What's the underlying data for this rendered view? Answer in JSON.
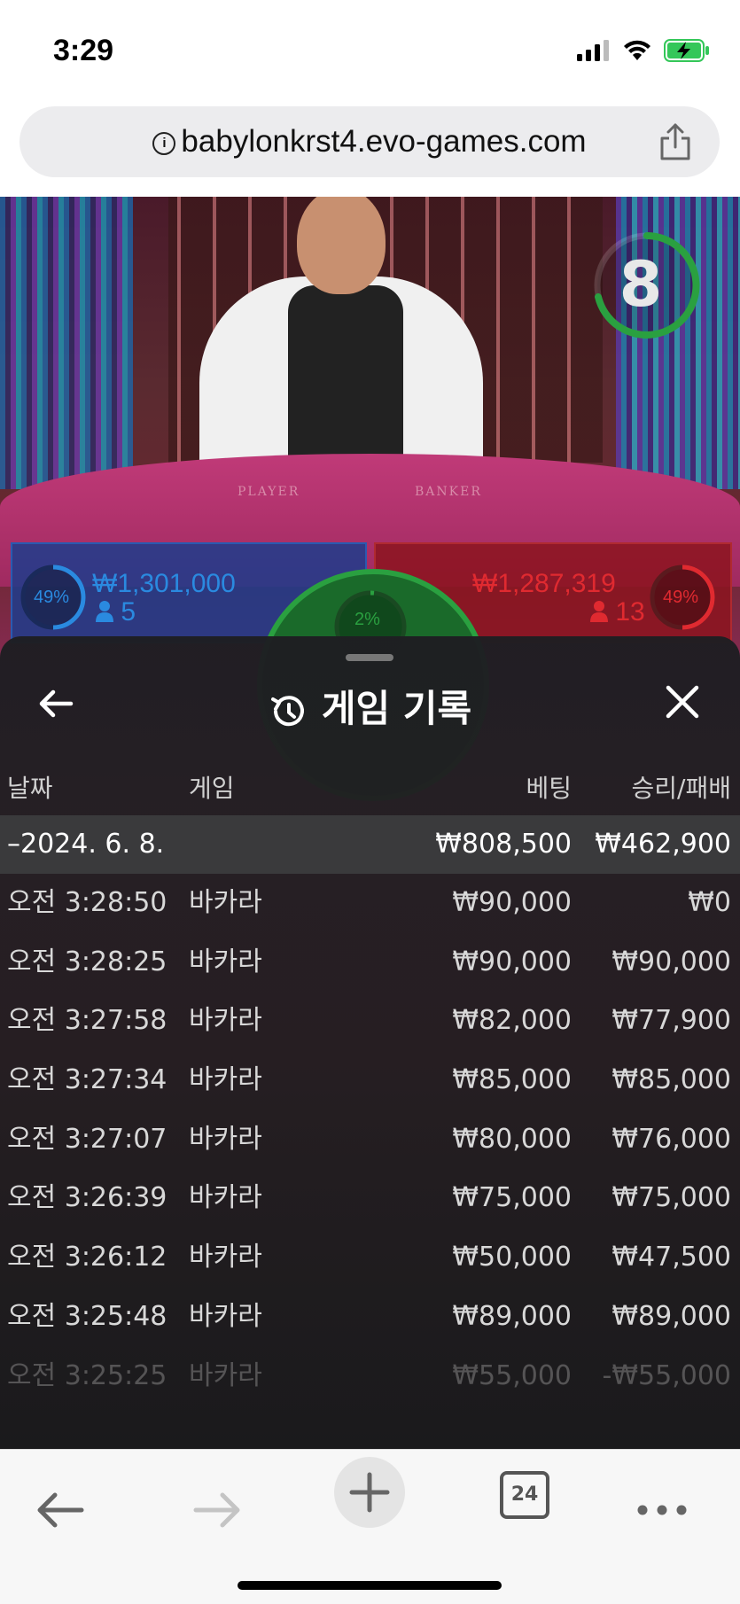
{
  "status_bar": {
    "time": "3:29"
  },
  "browser": {
    "url": "babylonkrst4.evo-games.com",
    "open_tabs": "24"
  },
  "game": {
    "timer": "8",
    "table_player_label": "PLAYER",
    "table_banker_label": "BANKER",
    "player": {
      "percent": "49%",
      "amount": "₩1,301,000",
      "count": "5"
    },
    "tie": {
      "percent": "2%"
    },
    "banker": {
      "percent": "49%",
      "amount": "₩1,287,319",
      "count": "13"
    }
  },
  "history_panel": {
    "title": "게임 기록",
    "columns": {
      "date": "날짜",
      "game": "게임",
      "bet": "베팅",
      "win_loss": "승리/패배"
    },
    "summary": {
      "date": "–2024. 6. 8.",
      "bet": "₩808,500",
      "win_loss": "₩462,900"
    },
    "rows": [
      {
        "time": "오전 3:28:50",
        "game": "바카라",
        "bet": "₩90,000",
        "win_loss": "₩0"
      },
      {
        "time": "오전 3:28:25",
        "game": "바카라",
        "bet": "₩90,000",
        "win_loss": "₩90,000"
      },
      {
        "time": "오전 3:27:58",
        "game": "바카라",
        "bet": "₩82,000",
        "win_loss": "₩77,900"
      },
      {
        "time": "오전 3:27:34",
        "game": "바카라",
        "bet": "₩85,000",
        "win_loss": "₩85,000"
      },
      {
        "time": "오전 3:27:07",
        "game": "바카라",
        "bet": "₩80,000",
        "win_loss": "₩76,000"
      },
      {
        "time": "오전 3:26:39",
        "game": "바카라",
        "bet": "₩75,000",
        "win_loss": "₩75,000"
      },
      {
        "time": "오전 3:26:12",
        "game": "바카라",
        "bet": "₩50,000",
        "win_loss": "₩47,500"
      },
      {
        "time": "오전 3:25:48",
        "game": "바카라",
        "bet": "₩89,000",
        "win_loss": "₩89,000"
      },
      {
        "time": "오전 3:25:25",
        "game": "바카라",
        "bet": "₩55,000",
        "win_loss": "-₩55,000"
      }
    ]
  },
  "icons": [
    "signal-icon",
    "wifi-icon",
    "battery-charging-icon",
    "info-icon",
    "share-icon",
    "back-arrow-icon",
    "history-icon",
    "close-icon",
    "nav-back-icon",
    "nav-forward-icon",
    "new-tab-plus-icon",
    "tabs-icon",
    "more-icon"
  ],
  "colors": {
    "player": "#2a8ae0",
    "banker": "#e02a30",
    "tie": "#2aa040",
    "battery": "#34c759"
  }
}
